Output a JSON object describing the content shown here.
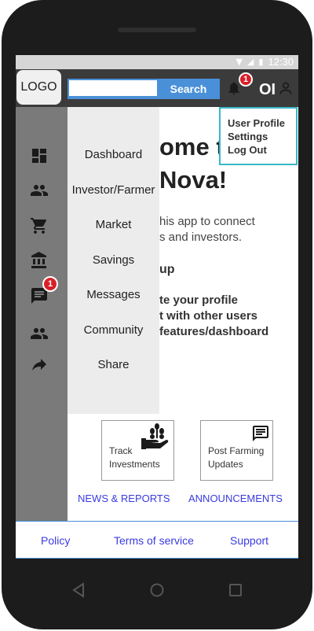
{
  "status": {
    "time": "12:30",
    "icons": [
      "wifi-icon",
      "signal-icon",
      "battery-icon"
    ]
  },
  "header": {
    "logo": "LOGO",
    "search_value": "",
    "search_button": "Search",
    "notification_count": "1",
    "initials": "OI"
  },
  "sidebar": {
    "icons": [
      "dashboard-icon",
      "people-icon",
      "cart-icon",
      "bank-icon",
      "chat-icon",
      "community-icon",
      "share-icon"
    ],
    "messages_badge": "1"
  },
  "menu": {
    "items": [
      "Dashboard",
      "Investor/Farmer",
      "Market",
      "Savings",
      "Messages",
      "Community",
      "Share"
    ]
  },
  "main": {
    "welcome_line1": "ome t",
    "welcome_line2": "Nova!",
    "desc_line1": "his app to connect",
    "desc_line2": "s and investors.",
    "setup_heading": "up",
    "steps": [
      "te your profile",
      "t with other users",
      "features/dashboard"
    ]
  },
  "cards": [
    {
      "label_line1": "Track",
      "label_line2": "Investments",
      "icon": "growth-hand-icon"
    },
    {
      "label_line1": "Post Farming",
      "label_line2": "Updates",
      "icon": "chat-icon"
    }
  ],
  "links": {
    "news": "NEWS & REPORTS",
    "announcements": "ANNOUNCEMENTS"
  },
  "footer": {
    "policy": "Policy",
    "terms": "Terms of service",
    "support": "Support"
  },
  "profile_menu": {
    "items": [
      "User Profile",
      "Settings",
      "Log Out"
    ]
  },
  "colors": {
    "accent": "#4a90d9",
    "link": "#3a3ae0",
    "badge": "#d9202a",
    "dropdown_border": "#37b8c8"
  }
}
